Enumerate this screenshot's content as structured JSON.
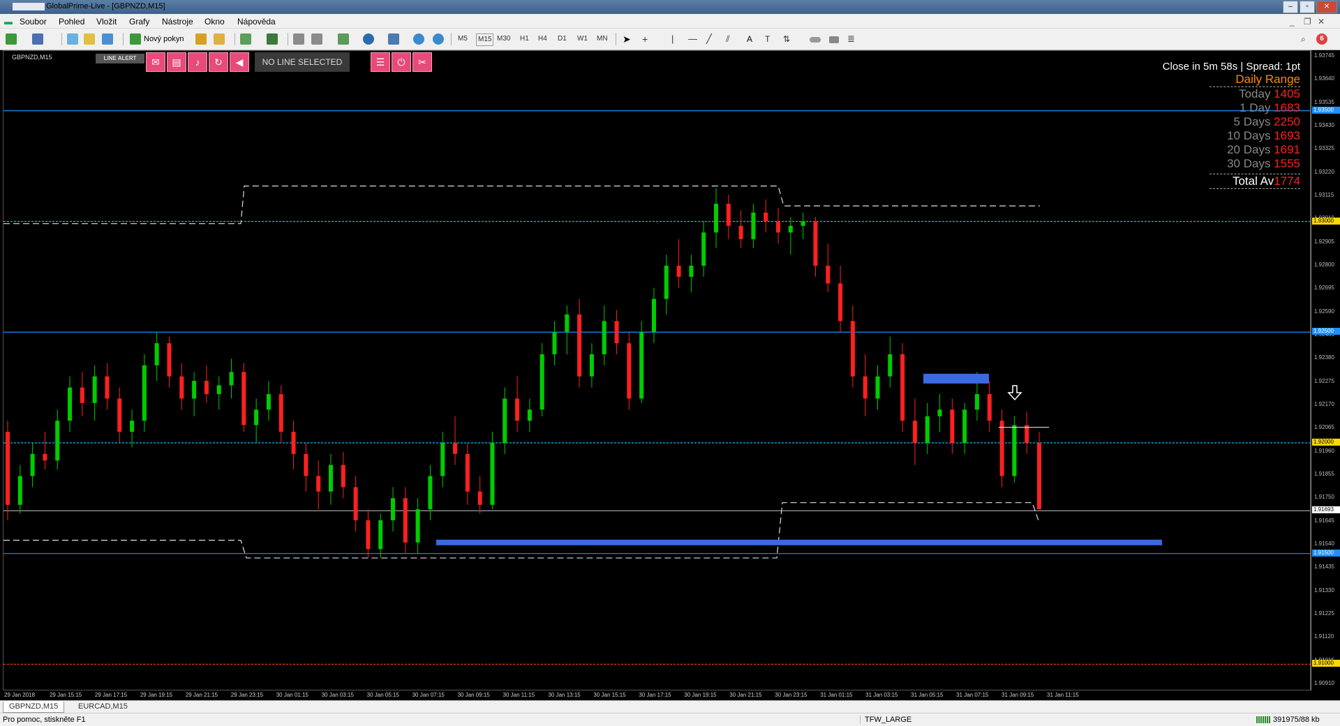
{
  "window": {
    "title": "GlobalPrime-Live - [GBPNZD,M15]"
  },
  "menu": [
    "Soubor",
    "Pohled",
    "Vložit",
    "Grafy",
    "Nástroje",
    "Okno",
    "Nápověda"
  ],
  "toolbar": {
    "new_order_label": "Nový pokyn",
    "timeframes": [
      "M5",
      "M15",
      "M30",
      "H1",
      "H4",
      "D1",
      "W1",
      "MN"
    ],
    "notification_count": "6"
  },
  "chart": {
    "symbol_label": "GBPNZD,M15",
    "line_alert_label": "LINE ALERT",
    "no_line_label": "NO LINE SELECTED",
    "close_info": "Close in 5m 58s | Spread: 1pt",
    "daily_range": {
      "title": "Daily Range",
      "rows": [
        {
          "label": "Today",
          "value": "1405"
        },
        {
          "label": "1 Day",
          "value": "1683"
        },
        {
          "label": "5 Days",
          "value": "2250"
        },
        {
          "label": "10 Days",
          "value": "1693"
        },
        {
          "label": "20 Days",
          "value": "1691"
        },
        {
          "label": "30 Days",
          "value": "1555"
        }
      ],
      "total_label": "Total Av",
      "total_value": "1774"
    }
  },
  "price_axis": {
    "ticks": [
      "1.93745",
      "1.93640",
      "1.93535",
      "1.93430",
      "1.93325",
      "1.93220",
      "1.93115",
      "1.93010",
      "1.92905",
      "1.92800",
      "1.92695",
      "1.92590",
      "1.92485",
      "1.92380",
      "1.92275",
      "1.92170",
      "1.92065",
      "1.91960",
      "1.91855",
      "1.91750",
      "1.91645",
      "1.91540",
      "1.91435",
      "1.91330",
      "1.91225",
      "1.91120",
      "1.91015",
      "1.90910"
    ],
    "labels": [
      {
        "text": "1.93500",
        "color": "#1e90ff"
      },
      {
        "text": "1.93000",
        "color": "#ffd700"
      },
      {
        "text": "1.92500",
        "color": "#1e90ff"
      },
      {
        "text": "1.92000",
        "color": "#ffd700"
      },
      {
        "text": "1.91693",
        "color": "#ffffff"
      },
      {
        "text": "1.91500",
        "color": "#1e90ff"
      },
      {
        "text": "1.91000",
        "color": "#ffd700"
      }
    ]
  },
  "time_axis": [
    "29 Jan 2018",
    "29 Jan 15:15",
    "29 Jan 17:15",
    "29 Jan 19:15",
    "29 Jan 21:15",
    "29 Jan 23:15",
    "30 Jan 01:15",
    "30 Jan 03:15",
    "30 Jan 05:15",
    "30 Jan 07:15",
    "30 Jan 09:15",
    "30 Jan 11:15",
    "30 Jan 13:15",
    "30 Jan 15:15",
    "30 Jan 17:15",
    "30 Jan 19:15",
    "30 Jan 21:15",
    "30 Jan 23:15",
    "31 Jan 01:15",
    "31 Jan 03:15",
    "31 Jan 05:15",
    "31 Jan 07:15",
    "31 Jan 09:15",
    "31 Jan 11:15"
  ],
  "tabs": [
    "GBPNZD,M15",
    "EURCAD,M15"
  ],
  "status": {
    "help": "Pro pomoc, stiskněte F1",
    "profile": "TFW_LARGE",
    "traffic": "391975/88 kb"
  },
  "colors": {
    "bull": "#00cc00",
    "bear": "#ff2020",
    "blue_line": "#1e90ff",
    "cyan_line": "#00bfff",
    "range_value": "#ff2020",
    "range_title": "#ff8c00"
  },
  "chart_data": {
    "type": "candlestick",
    "price_range": [
      1.9091,
      1.9375
    ],
    "candles": [
      [
        1.9205,
        1.921,
        1.9165,
        1.9172
      ],
      [
        1.9172,
        1.919,
        1.9168,
        1.9185
      ],
      [
        1.9185,
        1.92,
        1.918,
        1.9195
      ],
      [
        1.9195,
        1.9205,
        1.9188,
        1.9192
      ],
      [
        1.9192,
        1.9215,
        1.9188,
        1.921
      ],
      [
        1.921,
        1.923,
        1.9205,
        1.9225
      ],
      [
        1.9225,
        1.9232,
        1.9212,
        1.9218
      ],
      [
        1.9218,
        1.9235,
        1.921,
        1.923
      ],
      [
        1.923,
        1.9236,
        1.9215,
        1.922
      ],
      [
        1.922,
        1.9225,
        1.92,
        1.9205
      ],
      [
        1.9205,
        1.9215,
        1.9198,
        1.921
      ],
      [
        1.921,
        1.924,
        1.9205,
        1.9235
      ],
      [
        1.9235,
        1.925,
        1.9228,
        1.9245
      ],
      [
        1.9245,
        1.9248,
        1.9225,
        1.923
      ],
      [
        1.923,
        1.9236,
        1.9215,
        1.922
      ],
      [
        1.922,
        1.9232,
        1.9212,
        1.9228
      ],
      [
        1.9228,
        1.9235,
        1.9218,
        1.9222
      ],
      [
        1.9222,
        1.923,
        1.9215,
        1.9226
      ],
      [
        1.9226,
        1.9238,
        1.922,
        1.9232
      ],
      [
        1.9232,
        1.9236,
        1.9205,
        1.9208
      ],
      [
        1.9208,
        1.922,
        1.92,
        1.9215
      ],
      [
        1.9215,
        1.9228,
        1.921,
        1.9222
      ],
      [
        1.9222,
        1.9226,
        1.92,
        1.9205
      ],
      [
        1.9205,
        1.921,
        1.9188,
        1.9195
      ],
      [
        1.9195,
        1.92,
        1.9178,
        1.9185
      ],
      [
        1.9185,
        1.9192,
        1.917,
        1.9178
      ],
      [
        1.9178,
        1.9195,
        1.9172,
        1.919
      ],
      [
        1.919,
        1.9196,
        1.9175,
        1.918
      ],
      [
        1.918,
        1.9185,
        1.916,
        1.9165
      ],
      [
        1.9165,
        1.917,
        1.9148,
        1.9152
      ],
      [
        1.9152,
        1.9168,
        1.9148,
        1.9165
      ],
      [
        1.9165,
        1.918,
        1.916,
        1.9175
      ],
      [
        1.9175,
        1.918,
        1.915,
        1.9155
      ],
      [
        1.9155,
        1.9175,
        1.915,
        1.917
      ],
      [
        1.917,
        1.919,
        1.9165,
        1.9185
      ],
      [
        1.9185,
        1.9205,
        1.918,
        1.92
      ],
      [
        1.92,
        1.9212,
        1.919,
        1.9195
      ],
      [
        1.9195,
        1.92,
        1.9172,
        1.9178
      ],
      [
        1.9178,
        1.9185,
        1.9168,
        1.9172
      ],
      [
        1.9172,
        1.9205,
        1.917,
        1.92
      ],
      [
        1.92,
        1.9225,
        1.9195,
        1.922
      ],
      [
        1.922,
        1.923,
        1.9205,
        1.921
      ],
      [
        1.921,
        1.922,
        1.9205,
        1.9215
      ],
      [
        1.9215,
        1.9245,
        1.9212,
        1.924
      ],
      [
        1.924,
        1.9255,
        1.9235,
        1.925
      ],
      [
        1.925,
        1.9262,
        1.924,
        1.9258
      ],
      [
        1.9258,
        1.9265,
        1.9225,
        1.923
      ],
      [
        1.923,
        1.9245,
        1.9225,
        1.924
      ],
      [
        1.924,
        1.9262,
        1.9235,
        1.9255
      ],
      [
        1.9255,
        1.926,
        1.924,
        1.9245
      ],
      [
        1.9245,
        1.925,
        1.9215,
        1.922
      ],
      [
        1.922,
        1.9255,
        1.9218,
        1.925
      ],
      [
        1.925,
        1.927,
        1.9245,
        1.9265
      ],
      [
        1.9265,
        1.9285,
        1.9258,
        1.928
      ],
      [
        1.928,
        1.9292,
        1.927,
        1.9275
      ],
      [
        1.9275,
        1.9285,
        1.9268,
        1.928
      ],
      [
        1.928,
        1.93,
        1.9275,
        1.9295
      ],
      [
        1.9295,
        1.9315,
        1.9288,
        1.9308
      ],
      [
        1.9308,
        1.9312,
        1.9292,
        1.9298
      ],
      [
        1.9298,
        1.9305,
        1.9288,
        1.9292
      ],
      [
        1.9292,
        1.9308,
        1.9288,
        1.9304
      ],
      [
        1.9304,
        1.931,
        1.9295,
        1.93
      ],
      [
        1.93,
        1.9306,
        1.929,
        1.9295
      ],
      [
        1.9295,
        1.9302,
        1.9285,
        1.9298
      ],
      [
        1.9298,
        1.9304,
        1.9292,
        1.93
      ],
      [
        1.93,
        1.9302,
        1.9275,
        1.928
      ],
      [
        1.928,
        1.929,
        1.9268,
        1.9272
      ],
      [
        1.9272,
        1.928,
        1.925,
        1.9255
      ],
      [
        1.9255,
        1.9262,
        1.9225,
        1.923
      ],
      [
        1.923,
        1.924,
        1.9212,
        1.922
      ],
      [
        1.922,
        1.9235,
        1.9215,
        1.923
      ],
      [
        1.923,
        1.9248,
        1.9225,
        1.924
      ],
      [
        1.924,
        1.9245,
        1.9205,
        1.921
      ],
      [
        1.921,
        1.922,
        1.919,
        1.92
      ],
      [
        1.92,
        1.9218,
        1.9195,
        1.9212
      ],
      [
        1.9212,
        1.9222,
        1.9205,
        1.9215
      ],
      [
        1.9215,
        1.922,
        1.9195,
        1.92
      ],
      [
        1.92,
        1.9218,
        1.9195,
        1.9215
      ],
      [
        1.9215,
        1.9232,
        1.921,
        1.9222
      ],
      [
        1.9222,
        1.9228,
        1.9205,
        1.921
      ],
      [
        1.921,
        1.9215,
        1.918,
        1.9185
      ],
      [
        1.9185,
        1.9212,
        1.9182,
        1.9208
      ],
      [
        1.9208,
        1.9214,
        1.9195,
        1.92
      ],
      [
        1.92,
        1.9205,
        1.9178,
        1.917
      ]
    ]
  }
}
